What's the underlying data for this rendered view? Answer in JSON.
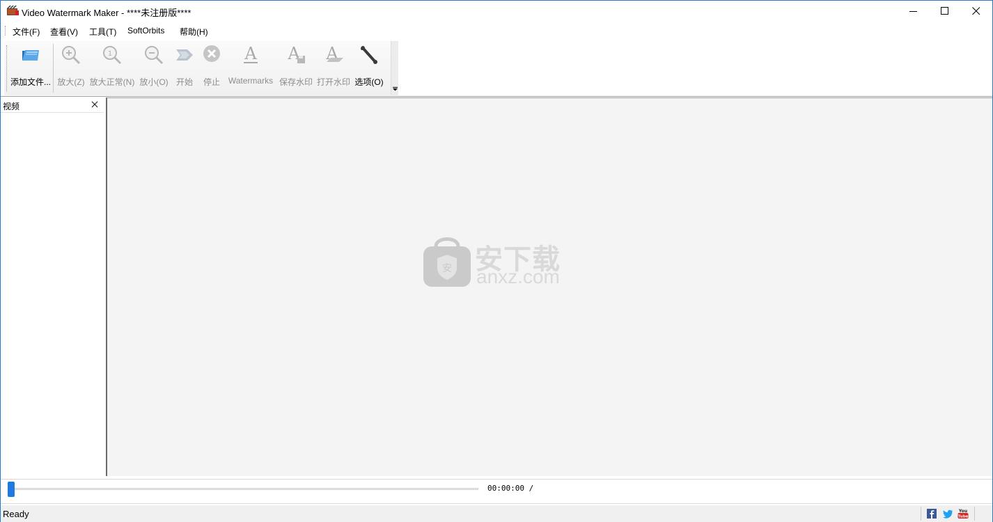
{
  "window": {
    "title": "Video Watermark Maker - ****未注册版****"
  },
  "menu": {
    "items": [
      "文件(F)",
      "查看(V)",
      "工具(T)",
      "SoftOrbits",
      "帮助(H)"
    ]
  },
  "toolbar": {
    "buttons": [
      {
        "label": "添加文件...",
        "icon": "add-files-folder-icon",
        "enabled": true
      },
      {
        "label": "放大(Z)",
        "icon": "zoom-in-icon",
        "enabled": false
      },
      {
        "label": "放大正常(N)",
        "icon": "zoom-normal-icon",
        "enabled": false
      },
      {
        "label": "放小(O)",
        "icon": "zoom-out-icon",
        "enabled": false
      },
      {
        "label": "开始",
        "icon": "start-arrow-icon",
        "enabled": false
      },
      {
        "label": "停止",
        "icon": "stop-icon",
        "enabled": false
      },
      {
        "label": "Watermarks",
        "icon": "watermark-text-icon",
        "enabled": false
      },
      {
        "label": "保存水印",
        "icon": "save-watermark-icon",
        "enabled": false
      },
      {
        "label": "打开水印",
        "icon": "open-watermark-icon",
        "enabled": false
      },
      {
        "label": "选项(O)",
        "icon": "wrench-icon",
        "enabled": true
      }
    ]
  },
  "panel": {
    "title": "视频"
  },
  "preview": {
    "watermark_main": "安下载",
    "watermark_sub": "anxz.com"
  },
  "player": {
    "time": "00:00:00 /",
    "progress": 0
  },
  "status": {
    "text": "Ready",
    "social": [
      "facebook-icon",
      "twitter-icon",
      "youtube-icon"
    ]
  },
  "colors": {
    "accent": "#1e7ae0",
    "window_border": "#2b78c5",
    "disabled_text": "#8d8d8d",
    "preview_bg": "#f4f4f4"
  }
}
